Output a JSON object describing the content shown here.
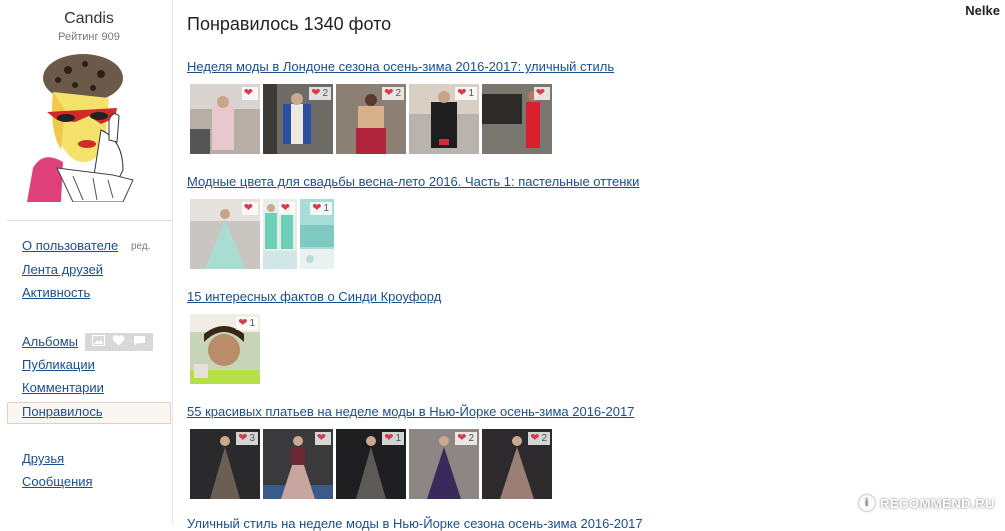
{
  "user": {
    "name": "Candis",
    "rating": "Рейтинг 909"
  },
  "top_user": "Nelke",
  "sidebar": {
    "links": [
      {
        "label": "О пользователе"
      },
      {
        "label": "Лента друзей"
      },
      {
        "label": "Активность"
      },
      {
        "label": "Альбомы"
      },
      {
        "label": "Публикации"
      },
      {
        "label": "Комментарии"
      },
      {
        "label": "Понравилось"
      },
      {
        "label": "Друзья"
      },
      {
        "label": "Сообщения"
      }
    ],
    "edit_label": "ред.",
    "active": "Понравилось"
  },
  "main": {
    "title": "Понравилось 1340 фото",
    "albums": [
      {
        "title": "Неделя моды в Лондоне сезона осень-зима 2016-2017: уличный стиль",
        "photos": [
          {
            "likes": ""
          },
          {
            "likes": "2"
          },
          {
            "likes": "2"
          },
          {
            "likes": "1"
          },
          {
            "likes": ""
          }
        ]
      },
      {
        "title": "Модные цвета для свадьбы весна-лето 2016. Часть 1: пастельные оттенки",
        "photos": [
          {
            "likes": ""
          },
          {
            "likes": ""
          },
          {
            "likes": "1"
          }
        ]
      },
      {
        "title": "15 интересных фактов о Синди Кроуфорд",
        "photos": [
          {
            "likes": "1"
          }
        ]
      },
      {
        "title": "55 красивых платьев на неделе моды в Нью-Йорке осень-зима 2016-2017",
        "photos": [
          {
            "likes": "3"
          },
          {
            "likes": ""
          },
          {
            "likes": "1"
          },
          {
            "likes": "2"
          },
          {
            "likes": "2"
          }
        ]
      }
    ],
    "cutoff_text": "Уличный стиль на неделе моды в Нью-Йорке сезона осень-зима 2016-2017"
  },
  "watermark": {
    "text": "RECOMMEND.RU",
    "badge": "i"
  },
  "icons": {
    "like": "heart-icon",
    "album_photo": "photo-icon",
    "album_like": "heart-icon",
    "album_comment": "comment-icon"
  },
  "colors": {
    "link": "#1a4f8c",
    "heart": "#d53c4b",
    "active_bg": "#faf7f2"
  }
}
